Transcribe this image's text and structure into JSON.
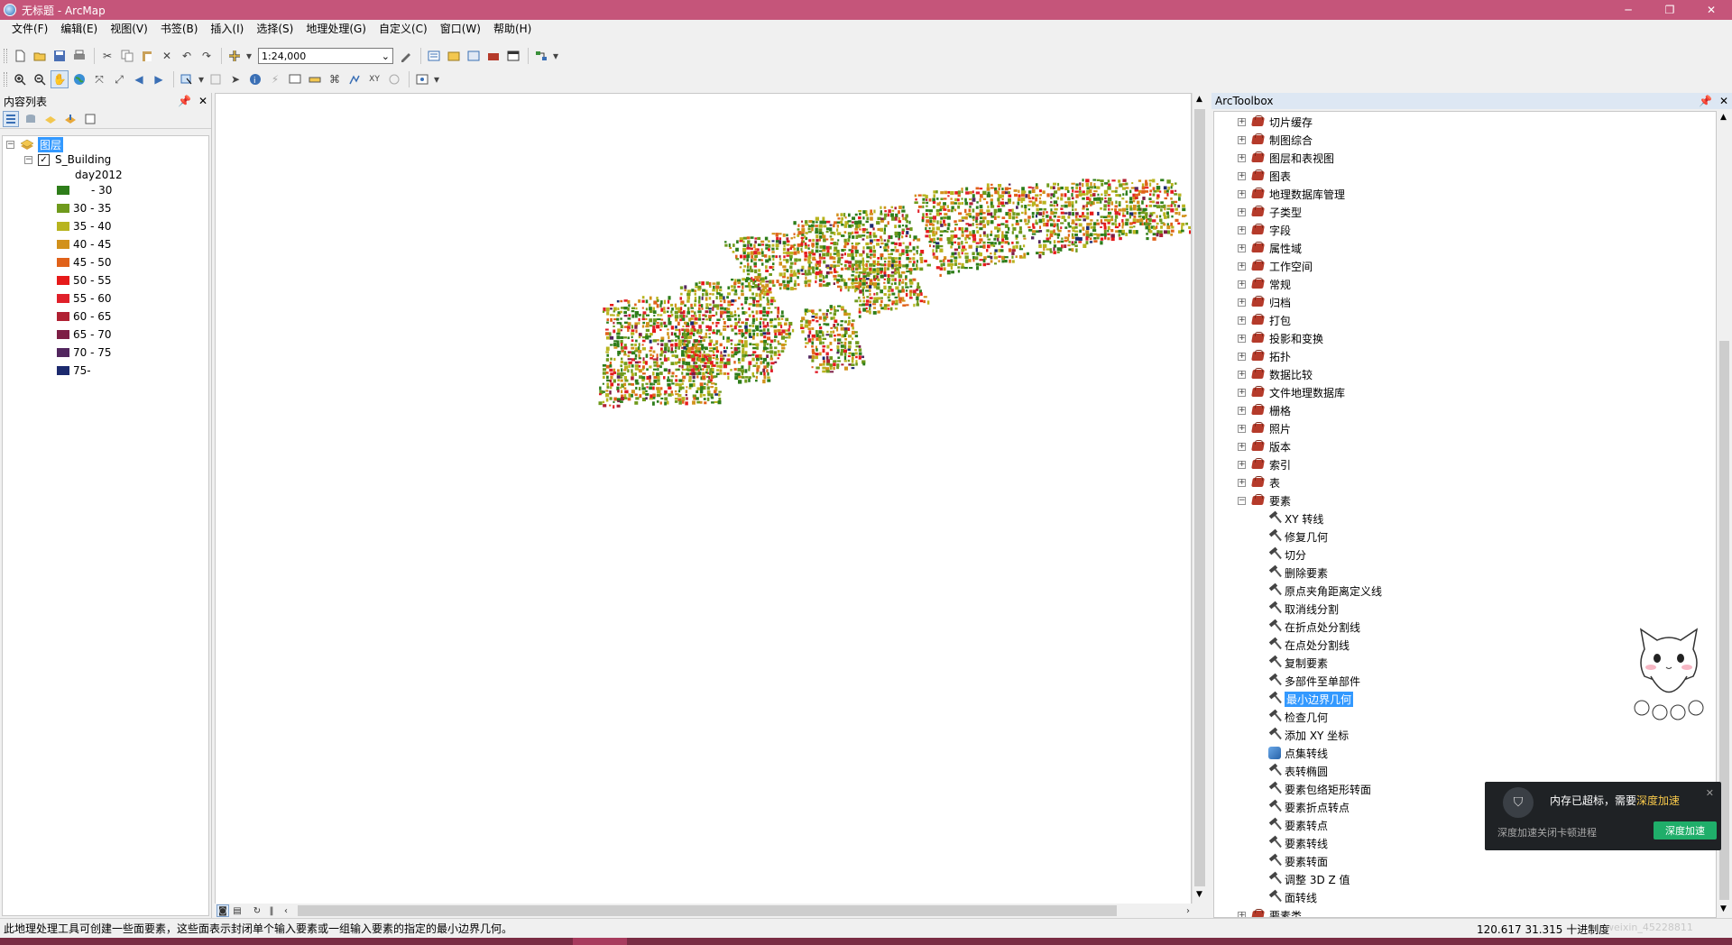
{
  "window": {
    "title": "无标题 - ArcMap",
    "controls": [
      "─",
      "❐",
      "✕"
    ]
  },
  "menu": [
    "文件(F)",
    "编辑(E)",
    "视图(V)",
    "书签(B)",
    "插入(I)",
    "选择(S)",
    "地理处理(G)",
    "自定义(C)",
    "窗口(W)",
    "帮助(H)"
  ],
  "toolbar": {
    "scale_value": "1:24,000"
  },
  "toc": {
    "title": "内容列表",
    "root_layer": "图层",
    "layer_name": "S_Building",
    "field_name": "day2012",
    "legend": [
      {
        "label": "- 30",
        "color": "#2e7d1a"
      },
      {
        "label": "30 - 35",
        "color": "#6f9a1c"
      },
      {
        "label": "35 - 40",
        "color": "#b8b41f"
      },
      {
        "label": "40 - 45",
        "color": "#d2911b"
      },
      {
        "label": "45 - 50",
        "color": "#e0621a"
      },
      {
        "label": "50 - 55",
        "color": "#e61a1a"
      },
      {
        "label": "55 - 60",
        "color": "#e0202a"
      },
      {
        "label": "60 - 65",
        "color": "#b02032"
      },
      {
        "label": "65 - 70",
        "color": "#7d1e45"
      },
      {
        "label": "70 - 75",
        "color": "#52265e"
      },
      {
        "label": "75-",
        "color": "#1c2a6e"
      }
    ]
  },
  "toolbox": {
    "title": "ArcToolbox",
    "toolsets": [
      "切片缓存",
      "制图综合",
      "图层和表视图",
      "图表",
      "地理数据库管理",
      "子类型",
      "字段",
      "属性域",
      "工作空间",
      "常规",
      "归档",
      "打包",
      "投影和变换",
      "拓扑",
      "数据比较",
      "文件地理数据库",
      "栅格",
      "照片",
      "版本",
      "索引",
      "表"
    ],
    "expanded_toolset": "要素",
    "tools": [
      "XY 转线",
      "修复几何",
      "切分",
      "删除要素",
      "原点夹角距离定义线",
      "取消线分割",
      "在折点处分割线",
      "在点处分割线",
      "复制要素",
      "多部件至单部件",
      "最小边界几何",
      "检查几何",
      "添加 XY 坐标",
      "点集转线",
      "表转椭圆",
      "要素包络矩形转面",
      "要素折点转点",
      "要素转点",
      "要素转线",
      "要素转面",
      "调整 3D Z 值",
      "面转线"
    ],
    "selected_tool": "最小边界几何",
    "script_tool": "点集转线",
    "partial_next": "要素类"
  },
  "notification": {
    "title_prefix": "内存已超标，需要",
    "title_accent": "深度加速",
    "subtitle": "深度加速关闭卡顿进程",
    "button": "深度加速",
    "close": "✕"
  },
  "status": {
    "message": "此地理处理工具可创建一些面要素，这些面表示封闭单个输入要素或一组输入要素的指定的最小边界几何。",
    "coords": "120.617  31.315 十进制度",
    "watermark": "weixin_45228811"
  }
}
